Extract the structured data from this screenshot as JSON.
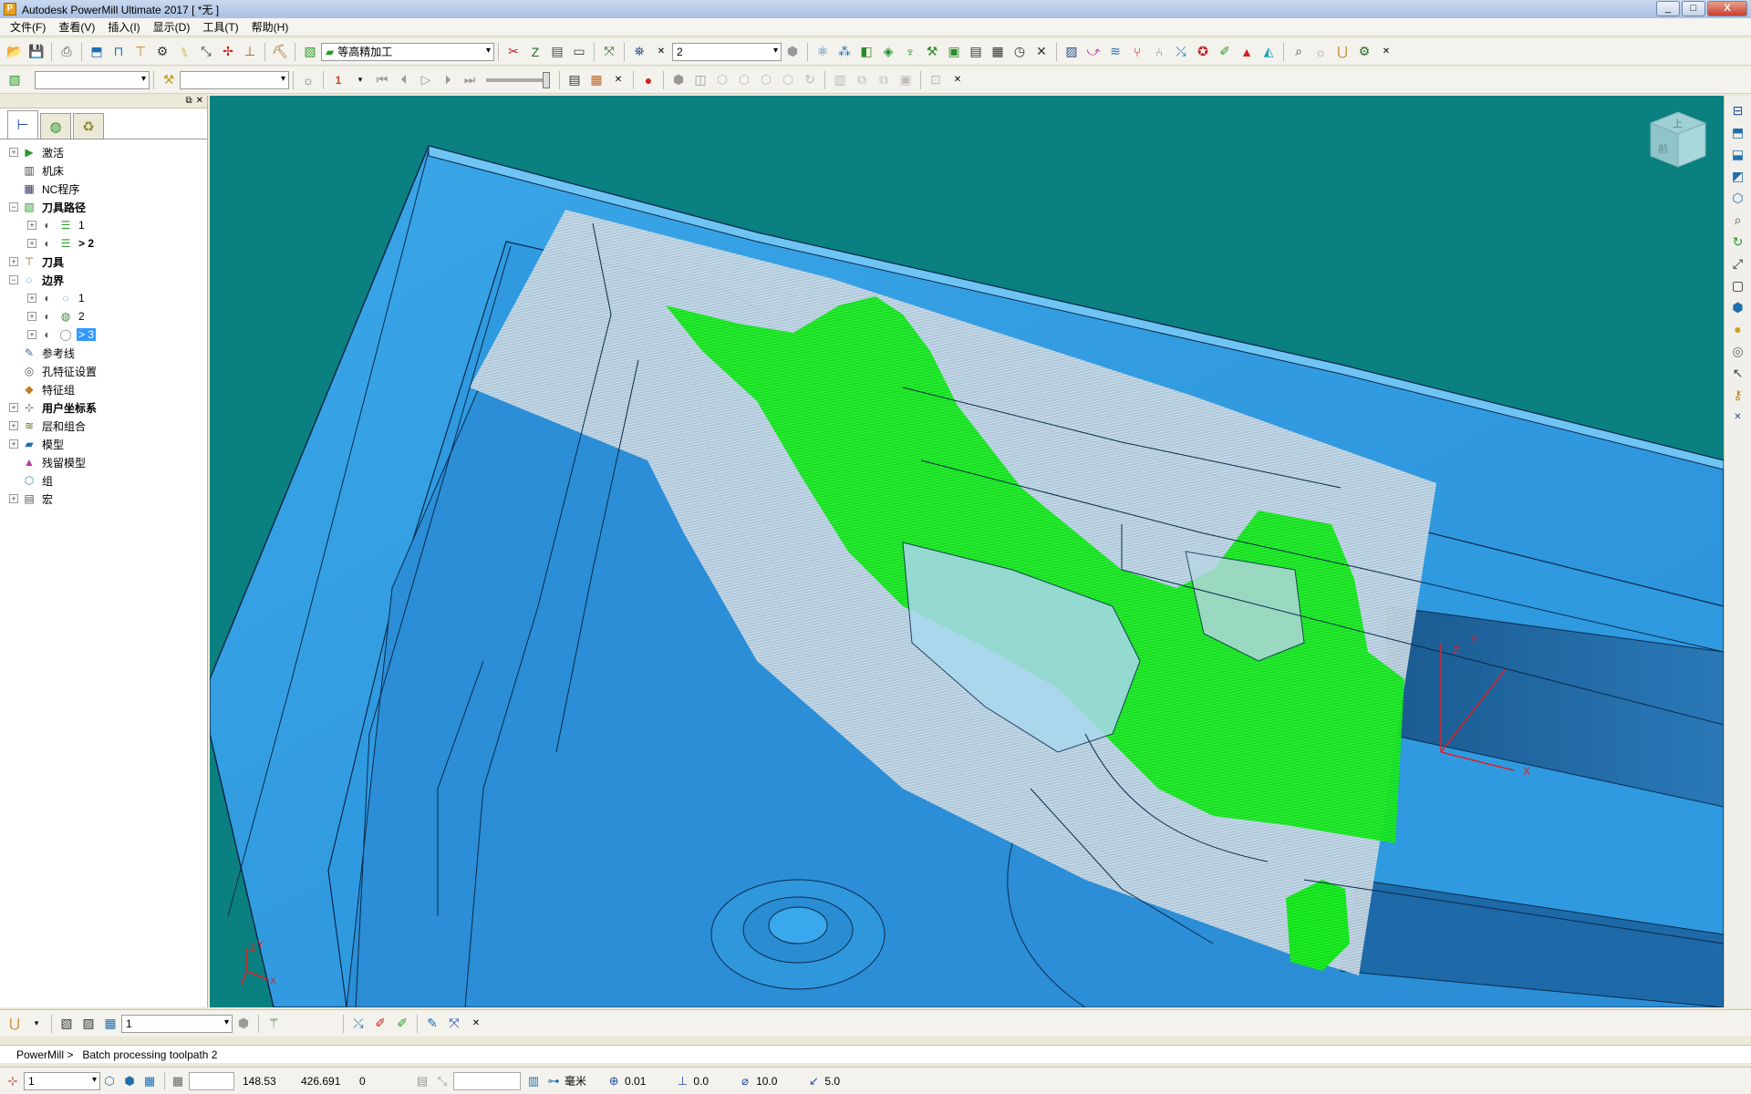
{
  "window": {
    "title": "Autodesk PowerMill Ultimate 2017   [ *无 ]",
    "min": "_",
    "max": "□",
    "close": "X"
  },
  "menu": [
    "文件(F)",
    "查看(V)",
    "插入(I)",
    "显示(D)",
    "工具(T)",
    "帮助(H)"
  ],
  "toolbar1": {
    "strategy_combo": "等高精加工",
    "toolpath_combo": "2"
  },
  "toolbar2": {
    "combo1": "",
    "combo2": "",
    "step": "1"
  },
  "explorer": {
    "tree": [
      {
        "label": "激活",
        "icon": "play-icon",
        "glyph": "▶",
        "color": "#2a9a2a",
        "bold": false,
        "expandable": true,
        "level": 0
      },
      {
        "label": "机床",
        "icon": "machine-icon",
        "glyph": "▥",
        "color": "#444",
        "bold": false,
        "expandable": false,
        "level": 0
      },
      {
        "label": "NC程序",
        "icon": "nc-program-icon",
        "glyph": "▦",
        "color": "#336",
        "bold": false,
        "expandable": false,
        "level": 0
      },
      {
        "label": "刀具路径",
        "icon": "toolpath-icon",
        "glyph": "▧",
        "color": "#2a9a2a",
        "bold": true,
        "expandable": true,
        "expanded": true,
        "level": 0
      },
      {
        "label": "1",
        "icon": "toolpath-item-icon",
        "glyph": "☰",
        "color": "#2a9a2a",
        "bold": false,
        "expandable": true,
        "level": 1
      },
      {
        "label": "> 2",
        "icon": "toolpath-item-icon",
        "glyph": "☰",
        "color": "#2a9a2a",
        "bold": true,
        "expandable": true,
        "level": 1
      },
      {
        "label": "刀具",
        "icon": "tool-icon",
        "glyph": "⊤",
        "color": "#a06020",
        "bold": true,
        "expandable": true,
        "level": 0
      },
      {
        "label": "边界",
        "icon": "boundary-icon",
        "glyph": "◌",
        "color": "#1f6fb0",
        "bold": true,
        "expandable": true,
        "expanded": true,
        "level": 0
      },
      {
        "label": "1",
        "icon": "boundary-item-icon",
        "glyph": "◌",
        "color": "#1f6fb0",
        "bold": false,
        "expandable": true,
        "level": 1
      },
      {
        "label": "2",
        "icon": "boundary-item-icon",
        "glyph": "◍",
        "color": "#3a8a3a",
        "bold": false,
        "expandable": true,
        "level": 1
      },
      {
        "label": "> 3",
        "icon": "boundary-item-icon",
        "glyph": "◯",
        "color": "#888",
        "bold": false,
        "expandable": true,
        "level": 1,
        "selected": true
      },
      {
        "label": "参考线",
        "icon": "pattern-icon",
        "glyph": "✎",
        "color": "#4a6aa0",
        "bold": false,
        "expandable": false,
        "level": 0
      },
      {
        "label": "孔特征设置",
        "icon": "hole-icon",
        "glyph": "◎",
        "color": "#555",
        "bold": false,
        "expandable": false,
        "level": 0
      },
      {
        "label": "特征组",
        "icon": "feature-group-icon",
        "glyph": "◆",
        "color": "#c08020",
        "bold": false,
        "expandable": false,
        "level": 0
      },
      {
        "label": "用户坐标系",
        "icon": "workplane-icon",
        "glyph": "⊹",
        "color": "#444",
        "bold": true,
        "expandable": true,
        "level": 0
      },
      {
        "label": "层和组合",
        "icon": "layers-icon",
        "glyph": "≋",
        "color": "#6a6a2a",
        "bold": false,
        "expandable": true,
        "level": 0
      },
      {
        "label": "模型",
        "icon": "model-icon",
        "glyph": "▰",
        "color": "#1f6fb0",
        "bold": false,
        "expandable": true,
        "level": 0
      },
      {
        "label": "残留模型",
        "icon": "stock-model-icon",
        "glyph": "▲",
        "color": "#b03aa0",
        "bold": false,
        "expandable": false,
        "level": 0
      },
      {
        "label": "组",
        "icon": "group-icon",
        "glyph": "⬡",
        "color": "#3a8aa0",
        "bold": false,
        "expandable": false,
        "level": 0
      },
      {
        "label": "宏",
        "icon": "macro-icon",
        "glyph": "▤",
        "color": "#555",
        "bold": false,
        "expandable": true,
        "level": 0
      }
    ]
  },
  "viewcube": {
    "top": "上",
    "front": "前"
  },
  "triad": {
    "x": "X",
    "y": "Y",
    "z": "Z"
  },
  "bottom_toolbar": {
    "combo": "1"
  },
  "cmdline": {
    "prompt": "PowerMill >",
    "text": "Batch processing toolpath 2"
  },
  "status": {
    "workplane": "1",
    "x": "148.53",
    "y": "426.691",
    "z": "0",
    "units": "毫米",
    "tolerance": "0.01",
    "thickness": "0.0",
    "diameter": "10.0",
    "stepdown": "5.0"
  },
  "colors": {
    "background": "#0a8080",
    "model": "#2f9fe6",
    "toolpath": "#17f01a",
    "boundary": "#c4d4e0"
  }
}
